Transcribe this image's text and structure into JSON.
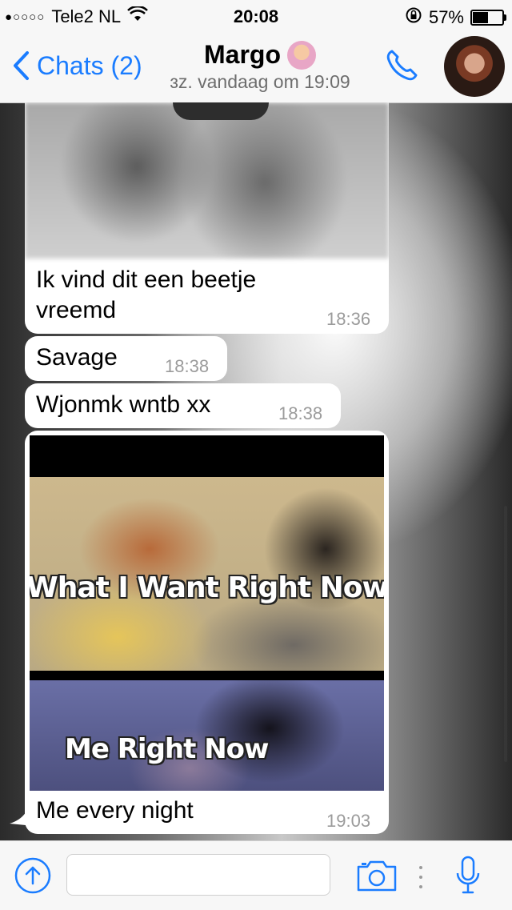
{
  "status_bar": {
    "signal_dots": "●○○○○",
    "carrier": "Tele2 NL",
    "time": "20:08",
    "battery_percent": "57%",
    "battery_level": 0.57
  },
  "nav": {
    "back_label": "Chats (2)",
    "contact_name": "Margo",
    "last_seen": "ɜz. vandaag om 19:09",
    "accent_color": "#1a7cff"
  },
  "messages": [
    {
      "type": "image",
      "image": "blurred photo",
      "text": "Ik vind dit een beetje vreemd",
      "text_line1": "Ik vind dit een beetje",
      "text_line2": "vreemd",
      "time": "18:36"
    },
    {
      "type": "text",
      "text": "Savage",
      "time": "18:38"
    },
    {
      "type": "text",
      "text": "Wjonmk wntb xx",
      "time": "18:38"
    },
    {
      "type": "image",
      "image": "meme",
      "meme_caption_top": "What I Want Right Now",
      "meme_caption_bottom": "Me Right Now",
      "text": "Me every night",
      "time": "19:03"
    }
  ],
  "input_bar": {
    "placeholder": "",
    "icons": [
      "upload-icon",
      "camera-icon",
      "microphone-icon"
    ]
  }
}
